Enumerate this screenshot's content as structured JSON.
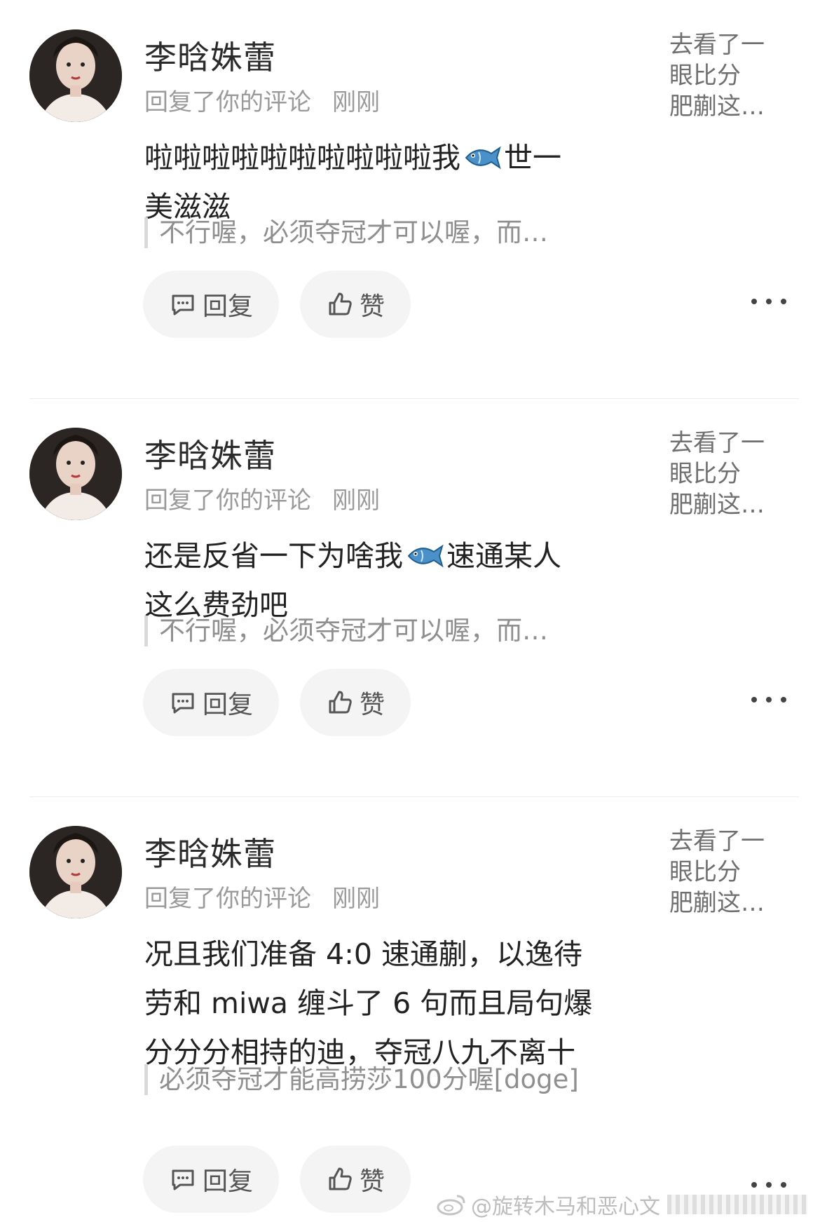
{
  "comments": [
    {
      "username": "李晗姝蕾",
      "action": "回复了你的评论",
      "time": "刚刚",
      "preview_lines": [
        "去看了一",
        "眼比分",
        "肥蒯这…"
      ],
      "body_lines": [
        {
          "before": "啦啦啦啦啦啦啦啦啦啦我",
          "emoji": "fish-emoji",
          "after": "世一"
        },
        {
          "before": "美滋滋",
          "emoji": null,
          "after": ""
        }
      ],
      "quote": "不行喔，必须夺冠才可以喔，而…",
      "reply_label": "回复",
      "like_label": "赞"
    },
    {
      "username": "李晗姝蕾",
      "action": "回复了你的评论",
      "time": "刚刚",
      "preview_lines": [
        "去看了一",
        "眼比分",
        "肥蒯这…"
      ],
      "body_lines": [
        {
          "before": "还是反省一下为啥我",
          "emoji": "fish-emoji",
          "after": "速通某人"
        },
        {
          "before": "这么费劲吧",
          "emoji": null,
          "after": ""
        }
      ],
      "quote": "不行喔，必须夺冠才可以喔，而…",
      "reply_label": "回复",
      "like_label": "赞"
    },
    {
      "username": "李晗姝蕾",
      "action": "回复了你的评论",
      "time": "刚刚",
      "preview_lines": [
        "去看了一",
        "眼比分",
        "肥蒯这…"
      ],
      "body_lines": [
        {
          "before": "况且我们准备 4:0 速通蒯，以逸待",
          "emoji": null,
          "after": ""
        },
        {
          "before": "劳和 miwa 缠斗了 6 句而且局句爆",
          "emoji": null,
          "after": ""
        },
        {
          "before": "分分分相持的迪，夺冠八九不离十",
          "emoji": null,
          "after": ""
        }
      ],
      "quote": "必须夺冠才能高捞莎100分喔[doge]",
      "reply_label": "回复",
      "like_label": "赞"
    }
  ],
  "watermark": "@旋转木马和恶心文",
  "icons": {
    "reply": "comment-bubble-icon",
    "like": "thumbs-up-icon",
    "more": "more-dots-icon",
    "weibo": "weibo-logo-icon"
  }
}
